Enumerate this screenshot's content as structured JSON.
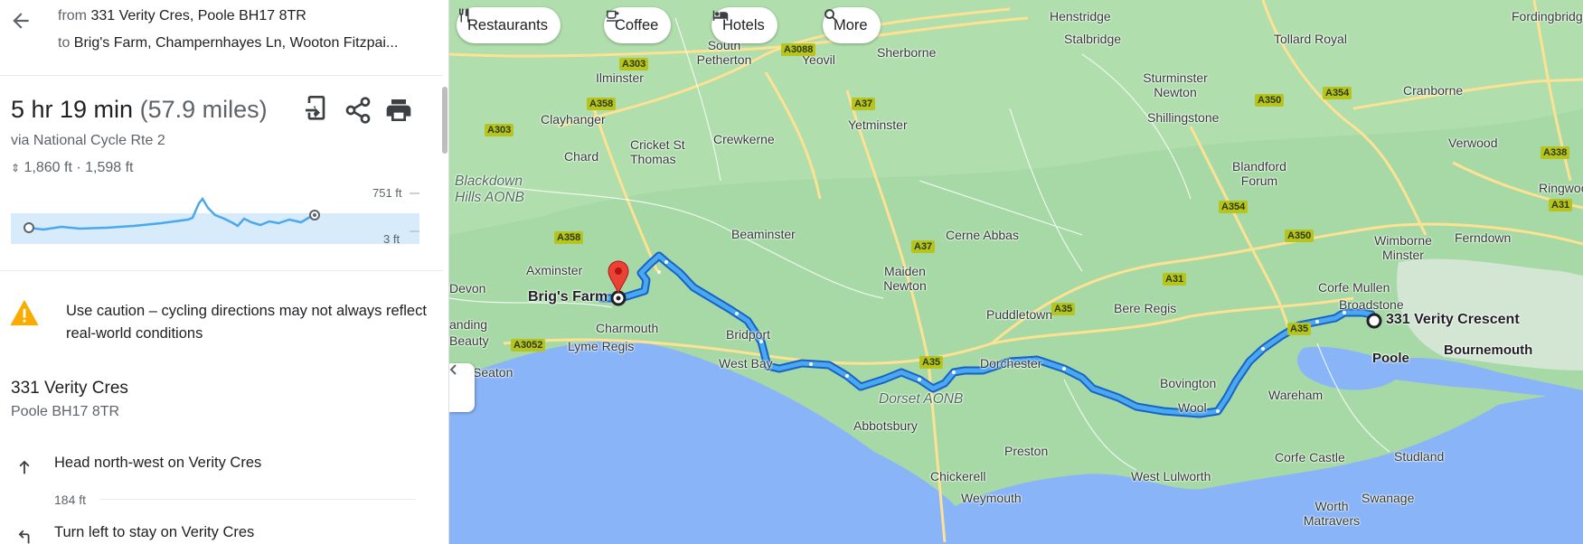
{
  "directions": {
    "from_prefix": "from",
    "from_value": "331 Verity Cres, Poole BH17 8TR",
    "to_prefix": "to",
    "to_value": "Brig's Farm, Champernhayes Ln, Wooton Fitzpai..."
  },
  "summary": {
    "duration": "5 hr 19 min",
    "distance": "(57.9 miles)",
    "via": "via National Cycle Rte 2",
    "elevation": "1,860 ft · 1,598 ft",
    "elev_max": "751 ft",
    "elev_min": "3 ft"
  },
  "caution": "Use caution – cycling directions may not always reflect real-world conditions",
  "start": {
    "title": "331 Verity Cres",
    "subtitle": "Poole BH17 8TR"
  },
  "steps": [
    {
      "text": "Head north-west on Verity Cres",
      "distance": "184 ft",
      "icon": "arrow-up-icon"
    },
    {
      "text": "Turn left to stay on Verity Cres",
      "icon": "turn-left-icon"
    }
  ],
  "chips": {
    "restaurants": "Restaurants",
    "coffee": "Coffee",
    "hotels": "Hotels",
    "more": "More"
  },
  "map": {
    "places": {
      "henstridge": "Henstridge",
      "stalbridge": "Stalbridge",
      "tollard_royal": "Tollard Royal",
      "south_petherton": "South Petherton",
      "sherborne": "Sherborne",
      "yeovil": "Yeovil",
      "ilminster": "Ilminster",
      "sturminster": "Sturminster Newton",
      "cranborne": "Cranborne",
      "verwood": "Verwood",
      "clayhanger": "Clayhanger",
      "cricket": "Cricket St Thomas",
      "crewkerne": "Crewkerne",
      "yetminster": "Yetminster",
      "shillingstone": "Shillingstone",
      "chard": "Chard",
      "blandford": "Blandford Forum",
      "ringwood": "Ringwood",
      "blackdown": "Blackdown Hills AONB",
      "beaminster": "Beaminster",
      "cerne": "Cerne Abbas",
      "wimborne": "Wimborne Minster",
      "ferndown": "Ferndown",
      "axminster": "Axminster",
      "maiden": "Maiden Newton",
      "brigs": "Brig's Farm",
      "devon": "Devon",
      "anding": "anding Beauty",
      "charmouth": "Charmouth",
      "corfe_mullen": "Corfe Mullen",
      "broadstone": "Broadstone",
      "puddletown": "Puddletown",
      "bere": "Bere Regis",
      "bridport": "Bridport",
      "verity": "331 Verity Crescent",
      "lyme": "Lyme Regis",
      "poole": "Poole",
      "bournemouth": "Bournemouth",
      "seaton": "Seaton",
      "west_bay": "West Bay",
      "dorchester": "Dorchester",
      "bovington": "Bovington",
      "wareham": "Wareham",
      "dorset_aonb": "Dorset AONB",
      "wool": "Wool",
      "abbotsbury": "Abbotsbury",
      "preston": "Preston",
      "corfe_castle": "Corfe Castle",
      "studland": "Studland",
      "chickerell": "Chickerell",
      "west_lulworth": "West Lulworth",
      "swanage": "Swanage",
      "weymouth": "Weymouth",
      "worth": "Worth Matravers",
      "fordingbridge": "Fordingbridge"
    },
    "roads": {
      "a303_1": "A303",
      "a3088": "A3088",
      "a358_1": "A358",
      "a37_1": "A37",
      "a350_1": "A350",
      "a354_1": "A354",
      "a303_2": "A303",
      "a338": "A338",
      "a31_1": "A31",
      "a354_2": "A354",
      "a358_2": "A358",
      "a37_2": "A37",
      "a350_2": "A350",
      "a31_2": "A31",
      "a35_1": "A35",
      "a35_2": "A35",
      "a3052": "A3052",
      "a35_3": "A35"
    },
    "colors": {
      "land": "#a7d9a6",
      "sea": "#8ab4f8",
      "route": "#1a73e8",
      "route_fill": "#4aa8f0",
      "pin": "#ea4335",
      "road": "#fde293"
    }
  }
}
